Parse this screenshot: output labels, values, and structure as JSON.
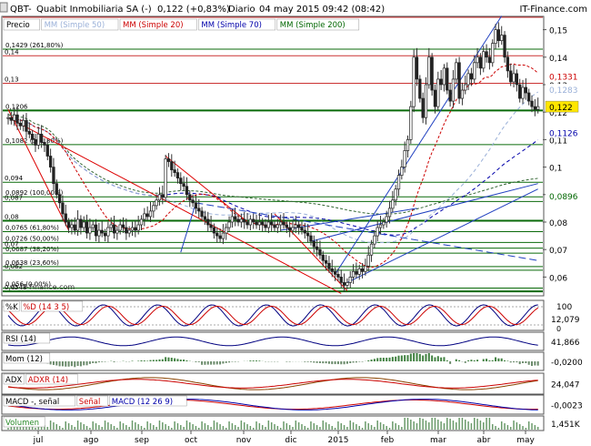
{
  "header": {
    "ticker": "QBT",
    "name": "Quabit Inmobiliaria SA (-)",
    "quote": "0,122 (+0,83%)",
    "period": "Diario",
    "datetime": "04 may 2015 09:42 (08:42)",
    "brand": "IT-Finance.com"
  },
  "legend": [
    {
      "label": "Precio",
      "color": "#000000"
    },
    {
      "label": "MM (Simple 50)",
      "color": "#9ab0d8"
    },
    {
      "label": "MM (Simple 20)",
      "color": "#cc0000"
    },
    {
      "label": "MM (Simple 70)",
      "color": "#0000aa"
    },
    {
      "label": "MM (Simple 200)",
      "color": "#006600"
    }
  ],
  "watermark": "© IT-Finance.com",
  "colors": {
    "up": "#008800",
    "down": "#cc0000",
    "candleWick": "#333333",
    "ma20": "#cc0000",
    "ma50": "#9ab0d8",
    "ma70": "#0000aa",
    "ma200": "#336633",
    "trend": "#2040c0",
    "redTrend": "#dd0000",
    "fib": "#0a6a0a"
  },
  "chart_data": {
    "type": "candlestick",
    "x_ticks": [
      "jul",
      "ago",
      "sep",
      "oct",
      "nov",
      "dic",
      "2015",
      "feb",
      "mar",
      "abr",
      "may"
    ],
    "y_ticks": [
      "0,15",
      "0,14",
      "0,13",
      "0,12",
      "0,11",
      "0,1",
      "0,09",
      "0,08",
      "0,07",
      "0,06"
    ],
    "ylim": [
      0.0535,
      0.1545
    ],
    "fib_levels": [
      {
        "label": "0,1429 (261,80%)",
        "value": 0.1429
      },
      {
        "label": "0,1206",
        "value": 0.1206
      },
      {
        "label": "0,1082 (161,80%)",
        "value": 0.1082
      },
      {
        "label": "0,0892 (100,00%)",
        "value": 0.0892
      },
      {
        "label": "0,0765 (61,80%)",
        "value": 0.0765
      },
      {
        "label": "0,0726 (50,00%)",
        "value": 0.0726
      },
      {
        "label": "0,0687 (38,20%)",
        "value": 0.0687
      },
      {
        "label": "0,0638 (23,60%)",
        "value": 0.0638
      },
      {
        "label": "0,056 (0,00%)",
        "value": 0.056
      }
    ],
    "side_labels": [
      {
        "label": "0,14",
        "value": 0.1405
      },
      {
        "label": "0,13",
        "value": 0.1305
      },
      {
        "label": "0,094",
        "value": 0.0945
      },
      {
        "label": "0,087",
        "value": 0.0875
      },
      {
        "label": "0,08",
        "value": 0.0805
      },
      {
        "label": "0,07",
        "value": 0.0705
      },
      {
        "label": "0,062",
        "value": 0.0625
      },
      {
        "label": "0,0548",
        "value": 0.0548
      }
    ],
    "right_badges": [
      {
        "label": "0,1331",
        "value": 0.1331,
        "bg": "#ffffff",
        "fg": "#cc0000"
      },
      {
        "label": "0,1283",
        "value": 0.1283,
        "bg": "#ffffff",
        "fg": "#9ab0d8"
      },
      {
        "label": "0,122",
        "value": 0.122,
        "bg": "#ffe600",
        "fg": "#000000"
      },
      {
        "label": "0,1126",
        "value": 0.1126,
        "bg": "#ffffff",
        "fg": "#0000aa"
      },
      {
        "label": "0,0896",
        "value": 0.0896,
        "bg": "#ffffff",
        "fg": "#006600"
      }
    ],
    "closes": [
      0.118,
      0.117,
      0.119,
      0.116,
      0.115,
      0.117,
      0.113,
      0.112,
      0.11,
      0.108,
      0.112,
      0.109,
      0.108,
      0.104,
      0.1,
      0.094,
      0.09,
      0.087,
      0.083,
      0.08,
      0.078,
      0.079,
      0.077,
      0.081,
      0.078,
      0.08,
      0.076,
      0.078,
      0.079,
      0.075,
      0.077,
      0.076,
      0.075,
      0.078,
      0.079,
      0.076,
      0.077,
      0.079,
      0.078,
      0.076,
      0.077,
      0.078,
      0.077,
      0.079,
      0.081,
      0.083,
      0.082,
      0.084,
      0.086,
      0.088,
      0.09,
      0.089,
      0.103,
      0.102,
      0.099,
      0.098,
      0.096,
      0.094,
      0.093,
      0.09,
      0.088,
      0.087,
      0.085,
      0.084,
      0.082,
      0.081,
      0.079,
      0.078,
      0.076,
      0.075,
      0.074,
      0.076,
      0.078,
      0.08,
      0.082,
      0.081,
      0.08,
      0.081,
      0.08,
      0.079,
      0.081,
      0.08,
      0.079,
      0.08,
      0.079,
      0.078,
      0.08,
      0.079,
      0.078,
      0.079,
      0.08,
      0.079,
      0.078,
      0.077,
      0.078,
      0.079,
      0.078,
      0.077,
      0.076,
      0.075,
      0.073,
      0.071,
      0.07,
      0.068,
      0.066,
      0.065,
      0.063,
      0.062,
      0.061,
      0.06,
      0.058,
      0.057,
      0.058,
      0.06,
      0.062,
      0.061,
      0.063,
      0.062,
      0.064,
      0.068,
      0.072,
      0.075,
      0.078,
      0.079,
      0.08,
      0.082,
      0.085,
      0.088,
      0.092,
      0.097,
      0.1,
      0.106,
      0.11,
      0.122,
      0.14,
      0.132,
      0.125,
      0.118,
      0.13,
      0.14,
      0.128,
      0.122,
      0.132,
      0.13,
      0.136,
      0.128,
      0.124,
      0.132,
      0.138,
      0.125,
      0.128,
      0.13,
      0.134,
      0.132,
      0.138,
      0.14,
      0.136,
      0.142,
      0.14,
      0.138,
      0.145,
      0.15,
      0.146,
      0.148,
      0.14,
      0.135,
      0.131,
      0.134,
      0.13,
      0.125,
      0.129,
      0.127,
      0.124,
      0.122,
      0.121,
      0.122
    ],
    "panels": [
      {
        "name": "%K",
        "label2": "%D (14 3 5)",
        "value": "12,079",
        "top_value": "100",
        "bottom_value": "0"
      },
      {
        "name": "RSI (14)",
        "value": "41,866"
      },
      {
        "name": "Mom (12)",
        "value": "-0,0200"
      },
      {
        "name": "ADX",
        "label2": "ADXR (14)",
        "value": "24,047"
      },
      {
        "name": "MACD -, señal",
        "label2": "Señal",
        "label3": "MACD (12 26 9)",
        "value": "-0,0023"
      },
      {
        "name": "Volumen",
        "value": "1,451K"
      }
    ]
  }
}
